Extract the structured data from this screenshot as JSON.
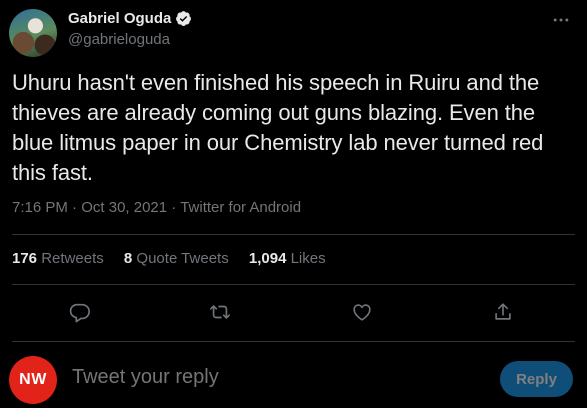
{
  "author": {
    "name": "Gabriel Oguda",
    "handle": "@gabrieloguda",
    "verified": true
  },
  "tweet": {
    "text": "Uhuru hasn't even finished his speech in Ruiru and the thieves are already coming out guns blazing. Even the blue litmus paper in our Chemistry lab never turned red this fast.",
    "time": "7:16 PM",
    "date": "Oct 30, 2021",
    "source": "Twitter for Android",
    "separator": " · "
  },
  "stats": {
    "retweets_count": "176",
    "retweets_label": "Retweets",
    "quote_count": "8",
    "quote_label": "Quote Tweets",
    "likes_count": "1,094",
    "likes_label": "Likes"
  },
  "reply": {
    "avatar_text": "NW",
    "placeholder": "Tweet your reply",
    "button_label": "Reply"
  },
  "icons": {
    "more": "more-icon",
    "reply": "reply-icon",
    "retweet": "retweet-icon",
    "like": "heart-icon",
    "share": "share-icon",
    "verified": "verified-badge-icon"
  },
  "colors": {
    "background": "#000000",
    "text": "#e7e9ea",
    "secondary": "#71767b",
    "divider": "#2f3336",
    "accent": "#1d9bf0",
    "reply_button": "#0f4e78",
    "reply_avatar": "#e2231a"
  }
}
